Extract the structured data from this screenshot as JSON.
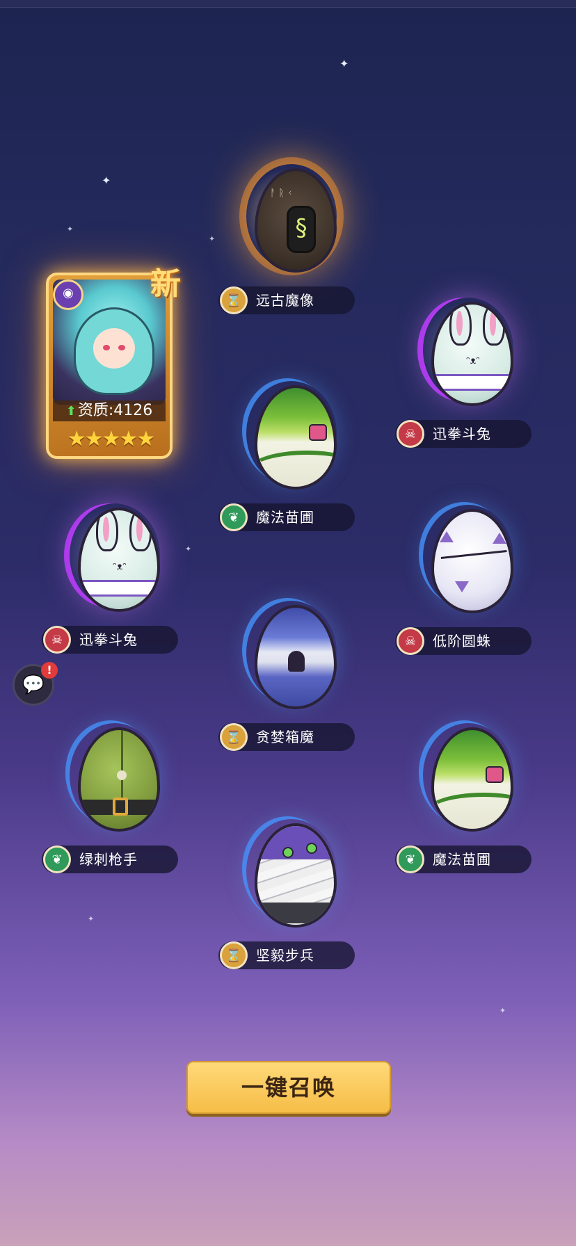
{
  "hero_card": {
    "new_tag": "新",
    "aptitude_label": "资质:4126",
    "stars": "★★★★★",
    "star_count": 5,
    "faction_icon": "eye-icon"
  },
  "slots": [
    {
      "name": "远古魔像",
      "faction": "gold",
      "icon": "hourglass-icon"
    },
    {
      "name": "迅拳斗兔",
      "faction": "red",
      "icon": "demon-mask-icon"
    },
    {
      "name": "魔法苗圃",
      "faction": "green",
      "icon": "leaf-icon"
    },
    {
      "name": "迅拳斗兔",
      "faction": "red",
      "icon": "demon-mask-icon"
    },
    {
      "name": "低阶圆蛛",
      "faction": "red",
      "icon": "demon-mask-icon"
    },
    {
      "name": "贪婪箱魔",
      "faction": "gold",
      "icon": "hourglass-icon"
    },
    {
      "name": "绿刺枪手",
      "faction": "green",
      "icon": "leaf-icon"
    },
    {
      "name": "魔法苗圃",
      "faction": "green",
      "icon": "leaf-icon"
    },
    {
      "name": "坚毅步兵",
      "faction": "gold",
      "icon": "hourglass-icon"
    }
  ],
  "buttons": {
    "summon_all": "一键召唤"
  },
  "colors": {
    "gold_faction": "#d9a23c",
    "green_faction": "#2f9a5a",
    "red_faction": "#c43a46",
    "button_yellow": "#f6bd47"
  }
}
